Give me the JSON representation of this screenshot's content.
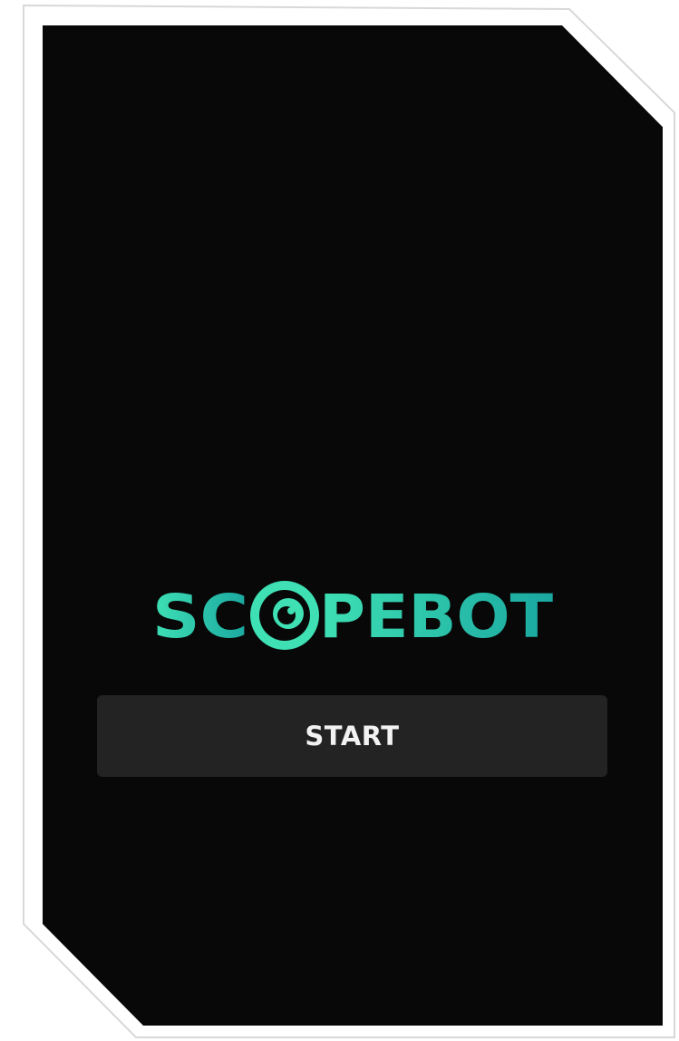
{
  "app": {
    "logo_text": "SCOPEBOT",
    "brand_color_start": "#3ee0b4",
    "brand_color_end": "#1aa7a0",
    "background_color": "#080808",
    "frame_color": "#ffffff"
  },
  "main": {
    "start_label": "START"
  }
}
